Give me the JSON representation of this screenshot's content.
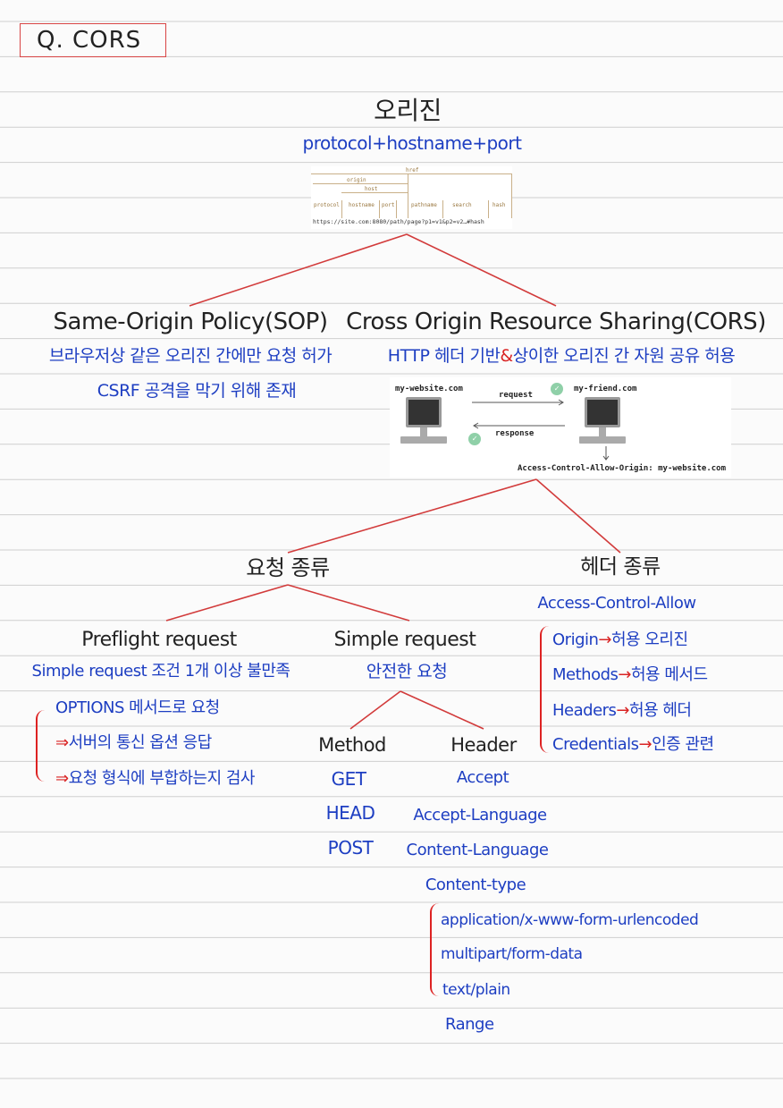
{
  "title": "Q. CORS",
  "origin": {
    "heading": "오리진",
    "formula": "protocol+hostname+port",
    "diagram": {
      "href": "href",
      "origin": "origin",
      "host": "host",
      "parts": [
        "protocol",
        "hostname",
        "port",
        "pathname",
        "search",
        "hash"
      ],
      "url": "https://site.com:8080/path/page?p1=v1&p2=v2…#hash"
    }
  },
  "sop": {
    "heading": "Same-Origin Policy(SOP)",
    "line1": "브라우저상 같은 오리진 간에만 요청 허가",
    "line2": "CSRF 공격을 막기 위해 존재"
  },
  "cors": {
    "heading": "Cross Origin Resource Sharing(CORS)",
    "line1_a": "HTTP 헤더 기반",
    "line1_amp": "&",
    "line1_b": "상이한 오리진 간 자원 공유 허용",
    "diagram": {
      "left_host": "my-website.com",
      "right_host": "my-friend.com",
      "request": "request",
      "response": "response",
      "header": "Access-Control-Allow-Origin: my-website.com"
    }
  },
  "request_types": {
    "heading": "요청 종류",
    "preflight": {
      "heading": "Preflight request",
      "desc": "Simple request 조건 1개 이상 불만족",
      "items": [
        "OPTIONS 메서드로 요청",
        "서버의 통신 옵션 응답",
        "요청 형식에 부합하는지 검사"
      ]
    },
    "simple": {
      "heading": "Simple request",
      "desc": "안전한 요청",
      "method_heading": "Method",
      "methods": [
        "GET",
        "HEAD",
        "POST"
      ],
      "header_heading": "Header",
      "headers": [
        "Accept",
        "Accept-Language",
        "Content-Language",
        "Content-type"
      ],
      "content_types": [
        "application/x-www-form-urlencoded",
        "multipart/form-data",
        "text/plain"
      ],
      "range": "Range"
    }
  },
  "header_types": {
    "heading": "헤더 종류",
    "prefix": "Access-Control-Allow",
    "items": [
      {
        "name": "Origin",
        "desc": "허용 오리진"
      },
      {
        "name": "Methods",
        "desc": "허용 메서드"
      },
      {
        "name": "Headers",
        "desc": "허용 헤더"
      },
      {
        "name": "Credentials",
        "desc": "인증 관련"
      }
    ],
    "arrow": "→"
  },
  "colors": {
    "ink": "#1d3ec2",
    "accent": "#d92424",
    "rule": "#c8c8c8"
  }
}
